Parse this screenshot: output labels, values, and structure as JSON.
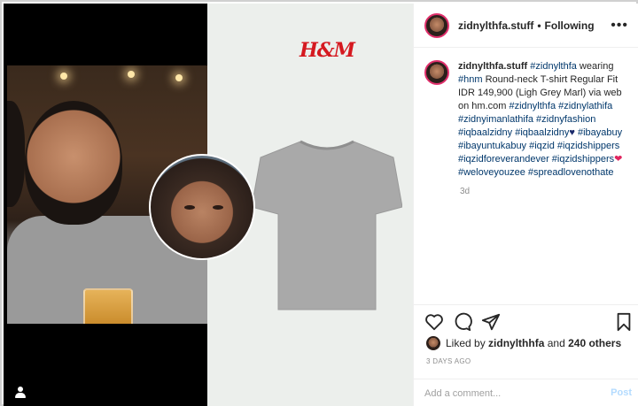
{
  "media": {
    "brand_logo": "H&M",
    "product_color": "#a9a9a9"
  },
  "header": {
    "username": "zidnylthfa.stuff",
    "separator": "•",
    "follow_status": "Following",
    "more_icon": "more-dots-icon"
  },
  "caption": {
    "username": "zidnylthfa.stuff",
    "mention_1": "#zidnylthfa",
    "text_1": " wearing ",
    "tag_hnm": "#hnm",
    "text_2": " Round-neck T-shirt Regular Fit IDR 149,900 (Ligh Grey Marl) via web on hm.com ",
    "tags_line": "#zidnylthfa #zidnylathifa #zidnyimanlathifa #zidnyfashion #iqbaalzidny #iqbaalzidny",
    "heart_blue": "♥",
    "tags_line_2": " #ibayabuy #ibayuntukabuy #iqzid #iqzidshippers #iqzidforeverandever #iqzidshippers",
    "heart_red": "❤",
    "tags_line_3": " #weloveyouzee #spreadlovenothate",
    "age": "3d"
  },
  "actions": {
    "like_icon": "heart-icon",
    "comment_icon": "comment-icon",
    "share_icon": "paper-plane-icon",
    "save_icon": "bookmark-icon"
  },
  "likes": {
    "prefix": "Liked by ",
    "user": "zidnylthhfa",
    "and": " and ",
    "others": "240 others"
  },
  "timestamp": "3 DAYS AGO",
  "comment": {
    "placeholder": "Add a comment...",
    "post_label": "Post"
  },
  "colors": {
    "link_blue": "#00376b",
    "post_disabled": "#b3dbff",
    "ring": "#e0306c",
    "hm_red": "#d51920"
  }
}
